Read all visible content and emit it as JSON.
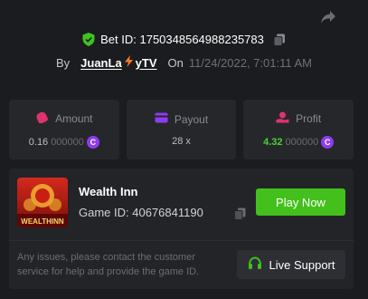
{
  "bet": {
    "id_label": "Bet ID: 1750348564988235783",
    "by_label": "By",
    "user_prefix": "JuanLa",
    "user_suffix": "yTV",
    "on_label": "On",
    "date": "11/24/2022, 7:01:11 AM"
  },
  "stats": {
    "amount": {
      "label": "Amount",
      "main": "0.16",
      "dim": "000000",
      "icon": "money-bag-icon"
    },
    "payout": {
      "label": "Payout",
      "value": "28 x",
      "icon": "wallet-icon"
    },
    "profit": {
      "label": "Profit",
      "main": "4.32",
      "dim": "000000",
      "icon": "hand-coin-icon"
    }
  },
  "coin_symbol": "C",
  "game": {
    "name": "Wealth Inn",
    "id_label": "Game ID: 40676841190",
    "thumb_text": "WEALTHINN",
    "play_label": "Play Now"
  },
  "help_text": "Any issues, please contact the customer service for help and provide the game ID.",
  "support_label": "Live Support",
  "colors": {
    "accent_green": "#43c01c",
    "profit_green": "#4cd137",
    "coin_purple": "#8e3cf0",
    "amount_pink": "#e0336e"
  }
}
